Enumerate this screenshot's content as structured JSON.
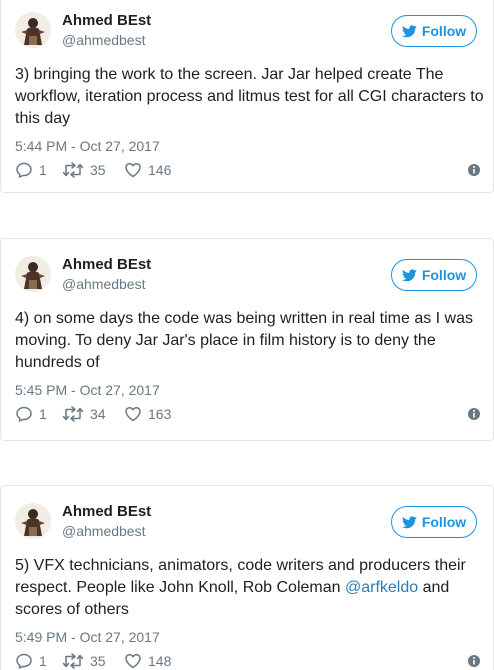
{
  "colors": {
    "accent": "#1b95e0",
    "link": "#2b7bb9",
    "meta": "#697882",
    "border": "#e1e8ed"
  },
  "follow_label": "Follow",
  "tweets": [
    {
      "name": "Ahmed BEst",
      "handle": "@ahmedbest",
      "text_parts": [
        "3) bringing the work to the screen. Jar Jar helped create The workflow, iteration process and litmus test for all CGI characters to this day"
      ],
      "time": "5:44 PM - Oct 27, 2017",
      "replies": "1",
      "retweets": "35",
      "likes": "146"
    },
    {
      "name": "Ahmed BEst",
      "handle": "@ahmedbest",
      "text_parts": [
        "4) on some days the code was being written in real time as I was moving. To deny Jar Jar's place in film history is to deny the hundreds of"
      ],
      "time": "5:45 PM - Oct 27, 2017",
      "replies": "1",
      "retweets": "34",
      "likes": "163"
    },
    {
      "name": "Ahmed BEst",
      "handle": "@ahmedbest",
      "text_parts": [
        "5) VFX technicians, animators, code writers and producers their respect. People like John Knoll, Rob Coleman ",
        "@arfkeldo",
        " and scores of others"
      ],
      "time": "5:49 PM - Oct 27, 2017",
      "replies": "1",
      "retweets": "35",
      "likes": "148"
    }
  ]
}
